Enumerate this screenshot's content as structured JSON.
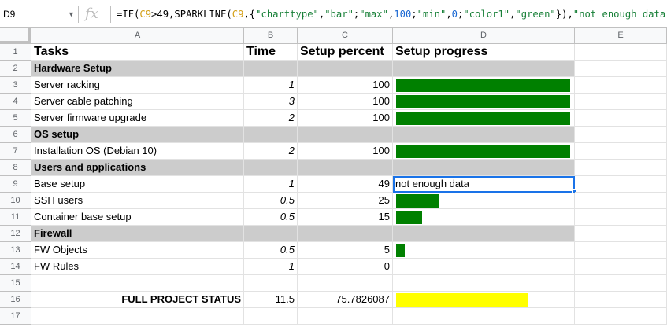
{
  "formula_bar": {
    "name_box": "D9",
    "fx_icon": "fx",
    "formula_parts": [
      {
        "t": "=IF(",
        "c": ""
      },
      {
        "t": "C9",
        "c": "f-ref"
      },
      {
        "t": ">49,SPARKLINE(",
        "c": ""
      },
      {
        "t": "C9",
        "c": "f-ref"
      },
      {
        "t": ",{",
        "c": ""
      },
      {
        "t": "\"charttype\"",
        "c": "f-str"
      },
      {
        "t": ",",
        "c": ""
      },
      {
        "t": "\"bar\"",
        "c": "f-str"
      },
      {
        "t": ";",
        "c": ""
      },
      {
        "t": "\"max\"",
        "c": "f-str"
      },
      {
        "t": ",",
        "c": ""
      },
      {
        "t": "100",
        "c": "f-num"
      },
      {
        "t": ";",
        "c": ""
      },
      {
        "t": "\"min\"",
        "c": "f-str"
      },
      {
        "t": ",",
        "c": ""
      },
      {
        "t": "0",
        "c": "f-num"
      },
      {
        "t": ";",
        "c": ""
      },
      {
        "t": "\"color1\"",
        "c": "f-str"
      },
      {
        "t": ",",
        "c": ""
      },
      {
        "t": "\"green\"",
        "c": "f-str"
      },
      {
        "t": "}),",
        "c": ""
      },
      {
        "t": "\"not enough data\"",
        "c": "f-str"
      },
      {
        "t": ")",
        "c": ""
      }
    ]
  },
  "columns": [
    "A",
    "B",
    "C",
    "D",
    "E"
  ],
  "colors": {
    "section_bg": "#cccccc",
    "bar_green": "#008000",
    "bar_yellow": "#ffff00",
    "selection": "#1a73e8"
  },
  "rows": [
    {
      "n": "1",
      "type": "header",
      "a": "Tasks",
      "b": "Time",
      "c": "Setup percent",
      "d": "Setup progress"
    },
    {
      "n": "2",
      "type": "section",
      "a": "Hardware Setup"
    },
    {
      "n": "3",
      "type": "task",
      "a": "Server racking",
      "b": "1",
      "c": "100",
      "bar": 1.0,
      "bar_color": "green"
    },
    {
      "n": "4",
      "type": "task",
      "a": "Server cable patching",
      "b": "3",
      "c": "100",
      "bar": 1.0,
      "bar_color": "green"
    },
    {
      "n": "5",
      "type": "task",
      "a": "Server firmware upgrade",
      "b": "2",
      "c": "100",
      "bar": 1.0,
      "bar_color": "green"
    },
    {
      "n": "6",
      "type": "section",
      "a": "OS setup"
    },
    {
      "n": "7",
      "type": "task",
      "a": "Installation OS (Debian 10)",
      "b": "2",
      "c": "100",
      "bar": 1.0,
      "bar_color": "green"
    },
    {
      "n": "8",
      "type": "section",
      "a": "Users and applications"
    },
    {
      "n": "9",
      "type": "task",
      "a": "Base setup",
      "b": "1",
      "c": "49",
      "d": "not enough data",
      "selected": true
    },
    {
      "n": "10",
      "type": "task",
      "a": "SSH users",
      "b": "0.5",
      "c": "25",
      "bar": 0.25,
      "bar_color": "green"
    },
    {
      "n": "11",
      "type": "task",
      "a": "Container base setup",
      "b": "0.5",
      "c": "15",
      "bar": 0.15,
      "bar_color": "green"
    },
    {
      "n": "12",
      "type": "section",
      "a": "Firewall"
    },
    {
      "n": "13",
      "type": "task",
      "a": "FW Objects",
      "b": "0.5",
      "c": "5",
      "bar": 0.05,
      "bar_color": "green"
    },
    {
      "n": "14",
      "type": "task",
      "a": "FW Rules",
      "b": "1",
      "c": "0"
    },
    {
      "n": "15",
      "type": "blank"
    },
    {
      "n": "16",
      "type": "status",
      "a": "FULL PROJECT STATUS",
      "b": "11.5",
      "c": "75.7826087",
      "bar": 0.7578,
      "bar_color": "yellow"
    },
    {
      "n": "17",
      "type": "blank"
    }
  ]
}
